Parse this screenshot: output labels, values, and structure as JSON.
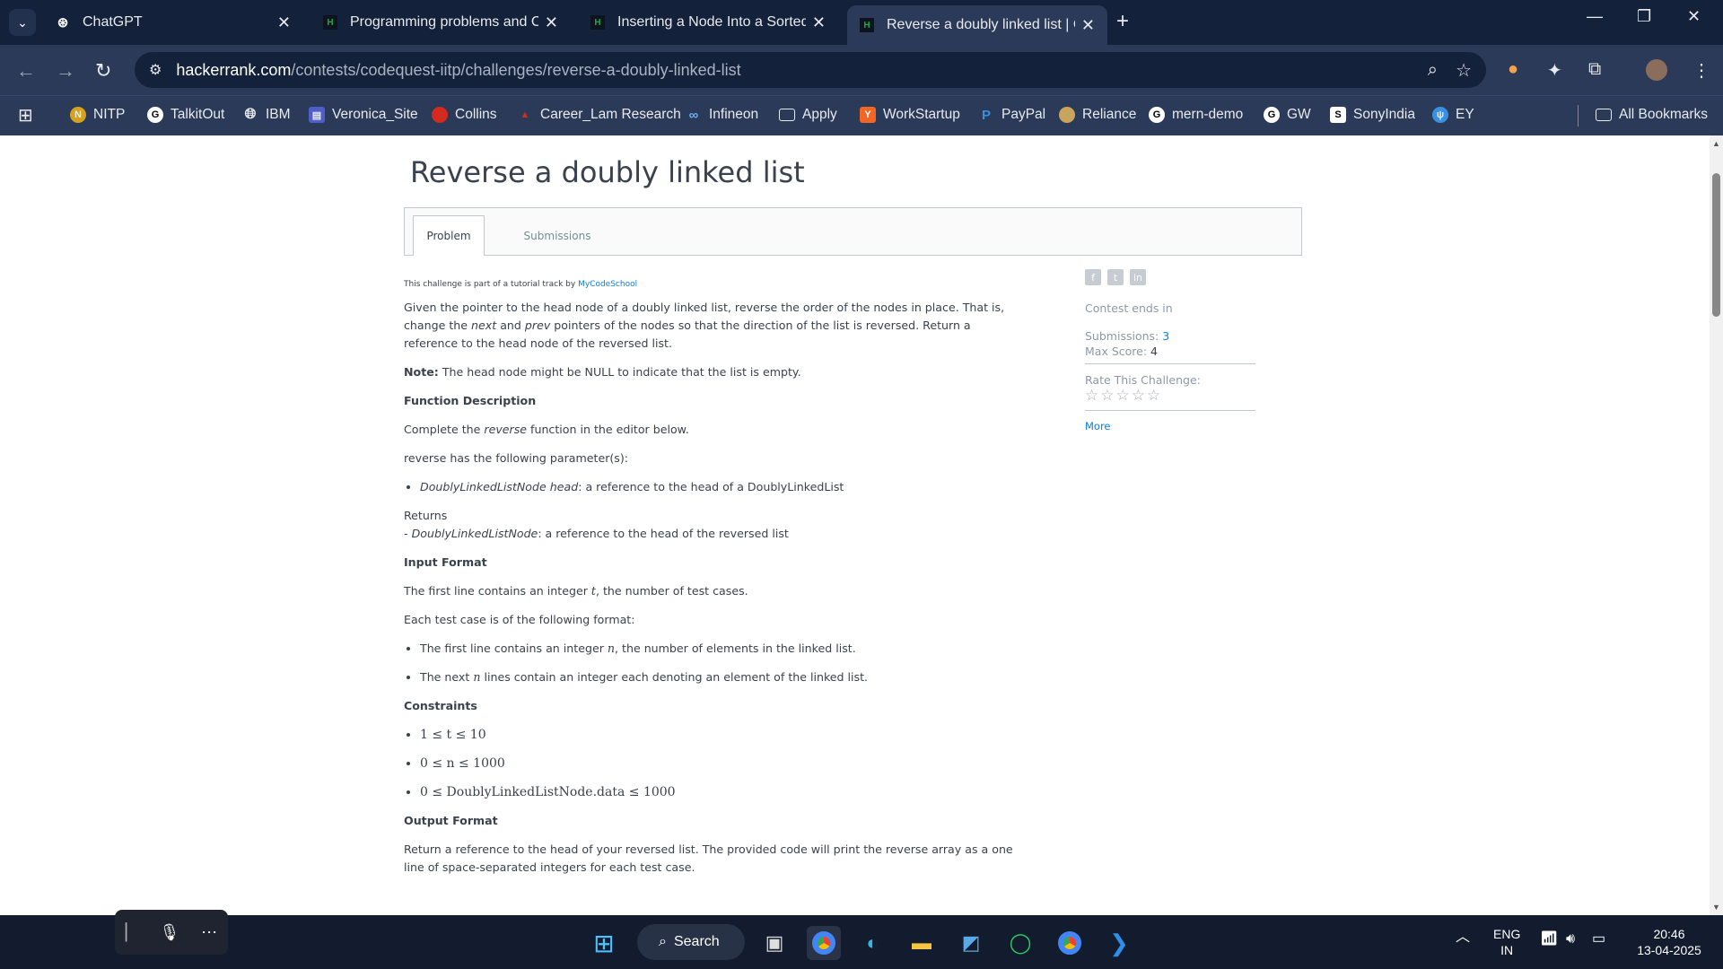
{
  "browser": {
    "tabs": [
      {
        "title": "ChatGPT",
        "active": false
      },
      {
        "title": "Programming problems and Co",
        "active": false
      },
      {
        "title": "Inserting a Node Into a Sorted",
        "active": false
      },
      {
        "title": "Reverse a doubly linked list | Co",
        "active": true
      }
    ],
    "url_host": "hackerrank.com",
    "url_path": "/contests/codequest-iitp/challenges/reverse-a-doubly-linked-list",
    "bookmarks": [
      "NITP",
      "TalkitOut",
      "IBM",
      "Veronica_Site",
      "Collins",
      "Career_Lam Research",
      "Infineon",
      "Apply",
      "WorkStartup",
      "PayPal",
      "Reliance",
      "mern-demo",
      "GW",
      "SonyIndia",
      "EY"
    ],
    "all_bookmarks": "All Bookmarks"
  },
  "problem": {
    "title": "Reverse a doubly linked list",
    "tab_problem": "Problem",
    "tab_submissions": "Submissions",
    "tutorial_prefix": "This challenge is part of a tutorial track by",
    "tutorial_link": "MyCodeSchool",
    "intro_1": "Given the pointer to the head node of a doubly linked list, reverse the order of the nodes in place. That is, change the",
    "intro_next": "next",
    "intro_and": "and",
    "intro_prev": "prev",
    "intro_2": "pointers of the nodes so that the direction of the list is reversed. Return a reference to the head node of the reversed list.",
    "note_label": "Note:",
    "note_text": "The head node might be NULL to indicate that the list is empty.",
    "func_desc_heading": "Function Description",
    "func_desc_1": "Complete the",
    "func_desc_fn": "reverse",
    "func_desc_2": "function in the editor below.",
    "params_intro": "reverse has the following parameter(s):",
    "param_name": "DoublyLinkedListNode head",
    "param_text": ": a reference to the head of a DoublyLinkedList",
    "returns_label": "Returns",
    "returns_dash": "- ",
    "returns_type": "DoublyLinkedListNode",
    "returns_text": ": a reference to the head of the reversed list",
    "input_heading": "Input Format",
    "input_1a": "The first line contains an integer",
    "input_1_var": "t",
    "input_1b": ", the number of test cases.",
    "input_2": "Each test case is of the following format:",
    "input_li1a": "The first line contains an integer",
    "input_li1_var": "n",
    "input_li1b": ", the number of elements in the linked list.",
    "input_li2a": "The next",
    "input_li2_var": "n",
    "input_li2b": "lines contain an integer each denoting an element of the linked list.",
    "constraints_heading": "Constraints",
    "constraint_1": "1 ≤ t ≤ 10",
    "constraint_2": "0 ≤ n ≤ 1000",
    "constraint_3": "0 ≤ DoublyLinkedListNode.data ≤ 1000",
    "output_heading": "Output Format",
    "output_text": "Return a reference to the head of your reversed list. The provided code will print the reverse array as a one line of space-separated integers for each test case."
  },
  "sidebar": {
    "contest_ends": "Contest ends in",
    "submissions_label": "Submissions:",
    "submissions_value": "3",
    "max_score_label": "Max Score:",
    "max_score_value": "4",
    "rate_label": "Rate This Challenge:",
    "stars": "☆☆☆☆☆",
    "more": "More"
  },
  "taskbar": {
    "search": "Search",
    "lang_1": "ENG",
    "lang_2": "IN",
    "time": "20:46",
    "date": "13-04-2025"
  }
}
